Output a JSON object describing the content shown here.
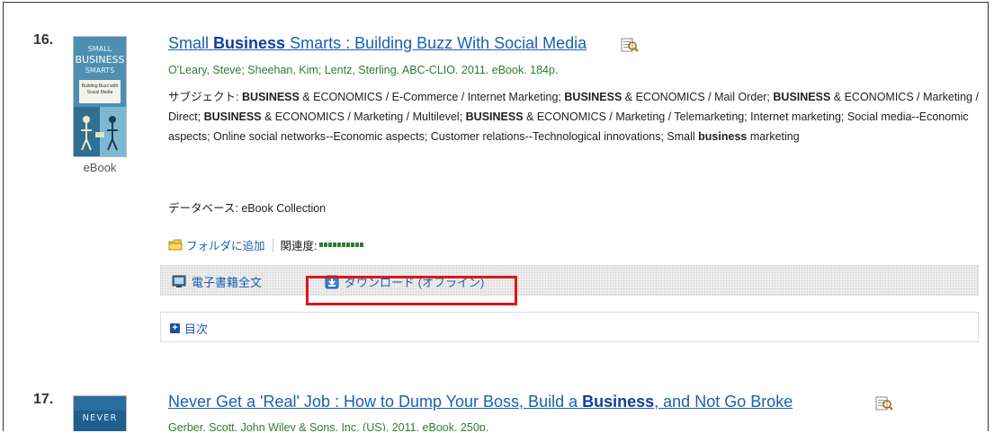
{
  "results": [
    {
      "number": "16.",
      "cover": {
        "line1": "SMALL",
        "line2": "BUSINESS",
        "line3": "SMARTS",
        "subtitle": "Building Buzz with Social Media"
      },
      "format_label": "eBook",
      "title": {
        "pre": "Small ",
        "bold": "Business",
        "post": " Smarts : Building Buzz With Social Media"
      },
      "authors": "O'Leary, Steve; Sheehan, Kim; Lentz, Sterling. ABC-CLIO. 2011. eBook. 184p.",
      "subjects": {
        "label": "サブジェクト: ",
        "s1": " & ECONOMICS / E-Commerce / Internet Marketing; ",
        "s2": " & ECONOMICS / Mail Order; ",
        "s3": " & ECONOMICS / Marketing / Direct; ",
        "s4": " & ECONOMICS / Marketing / Multilevel; ",
        "s5": " & ECONOMICS / Marketing / Telemarketing; Internet marketing; Social media--Economic aspects; Online social networks--Economic aspects; Customer relations--Technological innovations; Small ",
        "s6": " marketing",
        "BUSINESS": "BUSINESS",
        "business": "business"
      },
      "database": "データベース: eBook Collection",
      "add_to_folder": "フォルダに追加",
      "relevance_label": "関連度:",
      "relevance_level": 10,
      "tools": {
        "fulltext": "電子書籍全文",
        "download": "ダウンロード (オフライン)"
      },
      "toc": "目次"
    },
    {
      "number": "17.",
      "cover": {
        "line1": "NEVER"
      },
      "title": {
        "pre": "Never Get a 'Real' Job : How to Dump Your Boss, Build a ",
        "bold": "Business",
        "post": ", and Not Go Broke"
      },
      "authors": "Gerber, Scott. John Wiley & Sons, Inc. (US). 2011. eBook. 250p."
    }
  ],
  "colors": {
    "link": "#1a5fb4",
    "author": "#2e7d32",
    "highlight": "#e0141b"
  }
}
